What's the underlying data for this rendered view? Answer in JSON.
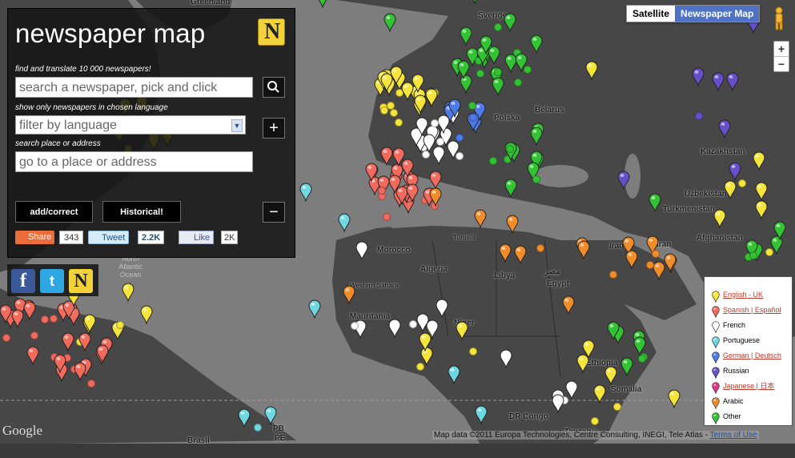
{
  "map_type": {
    "satellite": "Satellite",
    "newspaper_map": "Newspaper Map"
  },
  "panel": {
    "title": "newspaper map",
    "logo_letter": "N",
    "search_hint": "find and translate 10 000 newspapers!",
    "search_placeholder": "search a newspaper, pick and click",
    "language_hint": "show only newspapers in chosen language",
    "language_value": "filter by language",
    "place_hint": "search place or address",
    "place_placeholder": "go to a place or address",
    "add_correct_label": "add/correct",
    "historical_label": "Historical!",
    "share_label": "Share",
    "share_count": "343",
    "tweet_label": "Tweet",
    "tweet_count": "2.2K",
    "like_label": "Like",
    "like_count": "2K"
  },
  "social_icons": [
    "facebook-icon",
    "twitter-icon",
    "newspapermap-icon"
  ],
  "legend": [
    {
      "label": "English - UK",
      "color": "#f5e43a",
      "link": true
    },
    {
      "label": "Spanish | Español",
      "color": "#f06a5e",
      "link": true
    },
    {
      "label": "French",
      "color": "#ffffff",
      "link": false
    },
    {
      "label": "Portuguese",
      "color": "#6fd7e0",
      "link": false
    },
    {
      "label": "German | Deutsch",
      "color": "#4f7be8",
      "link": true
    },
    {
      "label": "Russian",
      "color": "#6650c8",
      "link": false
    },
    {
      "label": "Japanese | 日本",
      "color": "#e0378c",
      "link": true
    },
    {
      "label": "Arabic",
      "color": "#f08c2a",
      "link": false
    },
    {
      "label": "Other",
      "color": "#33c233",
      "link": false
    }
  ],
  "places": {
    "greenland": "Greenland",
    "sverige": "Sverige",
    "kazakhstan": "Kazakhstan",
    "uzbekistan": "Uzbekistan",
    "turkmenistan": "Turkmenistan",
    "afghanistan": "Afghanistan",
    "belarus": "Belarus",
    "polska": "Polska",
    "iraq": "Iraq",
    "iran": "Iran",
    "morocco": "Morocco",
    "algeria": "Algeria",
    "libya": "Libya",
    "egypt_ar": "مصر",
    "egypt": "Egypt",
    "tunisia": "Tunisia",
    "western_sahara": "Western Sahara",
    "mauritania": "Mauritania",
    "niger": "Niger",
    "ethiopia": "Ethiopia",
    "somalia": "Somalia",
    "dr_congo": "DR Congo",
    "tanzania": "Tanzania",
    "brasil": "Brasil",
    "pe": "PE",
    "pb": "PB",
    "north_atlantic": "North Atlantic Ocean"
  },
  "footer": {
    "attribution": "Map data ©2011 Europa Technologies, Centre Consulting, INEGI, Tele Atlas -",
    "terms": "Terms of Use"
  },
  "google_logo": "Google",
  "colors": {
    "english": "#f5e43a",
    "spanish": "#f06a5e",
    "french": "#ffffff",
    "portuguese": "#6fd7e0",
    "german": "#4f7be8",
    "russian": "#6650c8",
    "arabic": "#f08c2a",
    "other": "#33c233",
    "land": "#474747",
    "sea": "#7d7d7d",
    "accent": "#4d72c8"
  }
}
